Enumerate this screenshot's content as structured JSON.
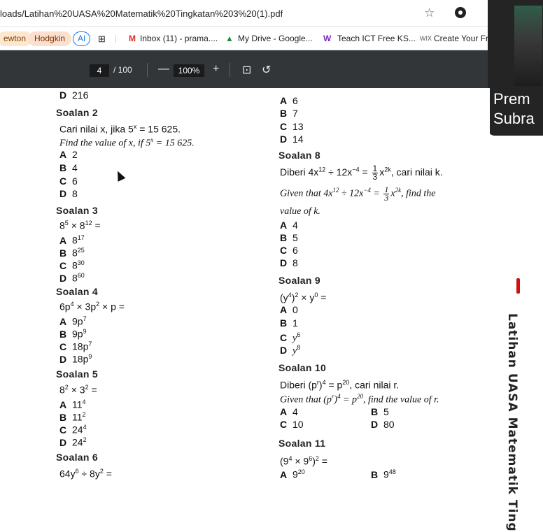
{
  "browser": {
    "url": "loads/Latihan%20UASA%20Matematik%20Tingkatan%203%20(1).pdf",
    "bookmarks": [
      "ewton",
      "Hodgkin",
      "AI",
      "Inbox (11) - prama....",
      "My Drive - Google...",
      "Teach ICT Free KS...",
      "Create Your Fr"
    ],
    "star_icon": "star-icon"
  },
  "pdf": {
    "page": "4",
    "total": "/ 100",
    "zoom": "100%",
    "minus": "—",
    "plus": "+"
  },
  "video": {
    "name_line1": "Prem",
    "name_line2": "Subra"
  },
  "sidebar_text": "Latihan UASA Matematik Ting",
  "doc": {
    "q1_d": "216",
    "s2": "Soalan 2",
    "s2_ms": "Cari nilai x, jika 5",
    "s2_ms_exp": "x",
    "s2_ms_rest": " = 15 625.",
    "s2_en": "Find the value of x, if 5",
    "s2_en_rest": " = 15 625.",
    "s2_opts": [
      "2",
      "4",
      "6",
      "8"
    ],
    "s3": "Soalan 3",
    "s3_q": "8",
    "s3_q_exp1": "5",
    "s3_q_mid": " × 8",
    "s3_q_exp2": "12",
    "s3_q_end": " =",
    "s3_base": "8",
    "s3_exps": [
      "17",
      "25",
      "30",
      "60"
    ],
    "s4": "Soalan 4",
    "s4_q": "6p",
    "s4_q_e1": "4",
    "s4_q_mid": " × 3p",
    "s4_q_e2": "2",
    "s4_q_end": " × p =",
    "s4_opts": [
      {
        "b": "9p",
        "e": "7"
      },
      {
        "b": "9p",
        "e": "9"
      },
      {
        "b": "18p",
        "e": "7"
      },
      {
        "b": "18p",
        "e": "9"
      }
    ],
    "s5": "Soalan 5",
    "s5_q": "8",
    "s5_q_e1": "2",
    "s5_q_mid": " × 3",
    "s5_q_e2": "2",
    "s5_q_end": " =",
    "s5_opts": [
      {
        "b": "11",
        "e": "4"
      },
      {
        "b": "11",
        "e": "2"
      },
      {
        "b": "24",
        "e": "4"
      },
      {
        "b": "24",
        "e": "2"
      }
    ],
    "s6": "Soalan 6",
    "s6_q": "64y",
    "s6_q_e1": "6",
    "s6_q_mid": " ÷ 8y",
    "s6_q_e2": "2",
    "s6_q_end": " =",
    "q1_opts": [
      "6",
      "7",
      "13",
      "14"
    ],
    "s8": "Soalan 8",
    "s8_ms_a": "Diberi 4x",
    "s8_e1": "12",
    "s8_ms_b": " ÷ 12x",
    "s8_e2": "−4",
    "s8_ms_c": " = ",
    "s8_frac_num": "1",
    "s8_frac_den": "3",
    "s8_ms_d": "x",
    "s8_e3": "2k",
    "s8_ms_e": ", cari nilai k.",
    "s8_en_a": "Given  that  4x",
    "s8_en_b": "  ÷  12x",
    "s8_en_c": "  =  ",
    "s8_en_e": ",  find  the",
    "s8_en_2": "value of k.",
    "s8_opts": [
      "4",
      "5",
      "6",
      "8"
    ],
    "s9": "Soalan 9",
    "s9_q_a": "(y",
    "s9_q_e1": "4",
    "s9_q_b": ")",
    "s9_q_e2": "2",
    "s9_q_c": " × y",
    "s9_q_e3": "0",
    "s9_q_d": " =",
    "s9_opts": [
      {
        "b": "0",
        "e": ""
      },
      {
        "b": "1",
        "e": ""
      },
      {
        "b": "y",
        "e": "6"
      },
      {
        "b": "y",
        "e": "8"
      }
    ],
    "s10": "Soalan 10",
    "s10_ms_a": "Diberi (p",
    "s10_e1": "r",
    "s10_ms_b": ")",
    "s10_e2": "4",
    "s10_ms_c": " = p",
    "s10_e3": "20",
    "s10_ms_d": ", cari nilai r.",
    "s10_en_a": "Given that (p",
    "s10_en_d": ", find the value of r.",
    "s10_opts": [
      "4",
      "5",
      "10",
      "80"
    ],
    "s11": "Soalan 11",
    "s11_q_a": "(9",
    "s11_e1": "4",
    "s11_q_b": " × 9",
    "s11_e2": "6",
    "s11_q_c": ")",
    "s11_e3": "2",
    "s11_q_d": " =",
    "s11_opts": [
      {
        "b": "9",
        "e": "20"
      },
      {
        "b": "9",
        "e": "48"
      }
    ],
    "letters": [
      "A",
      "B",
      "C",
      "D"
    ]
  }
}
